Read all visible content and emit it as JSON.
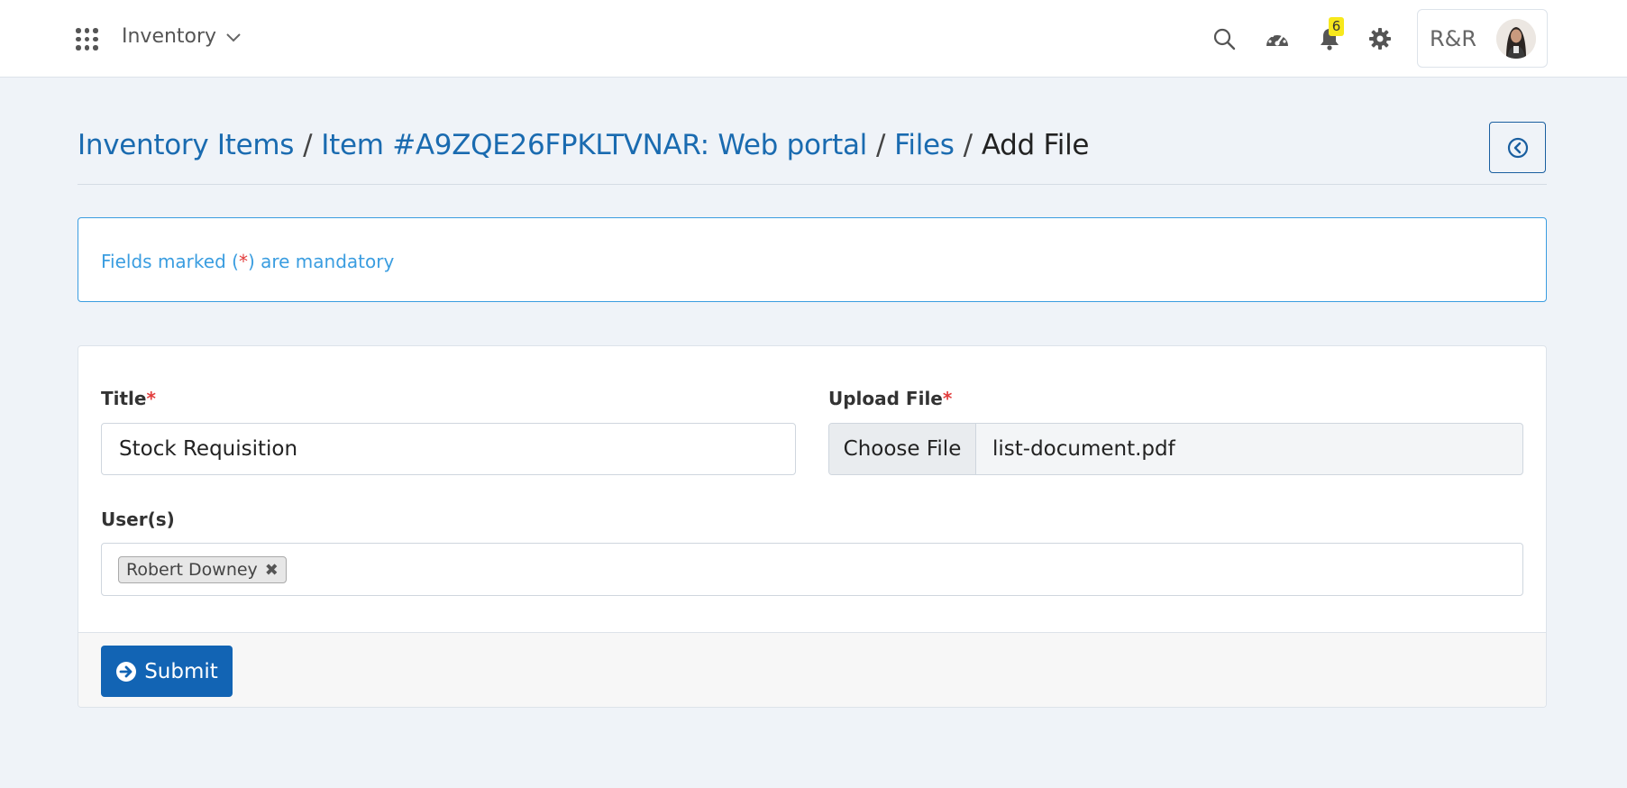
{
  "topbar": {
    "module_name": "Inventory",
    "notification_count": "6",
    "user_initials": "R&R"
  },
  "breadcrumb": {
    "items": [
      "Inventory Items",
      "Item #A9ZQE26FPKLTVNAR: Web portal",
      "Files"
    ],
    "current": "Add File",
    "separator": "/"
  },
  "alert": {
    "prefix": "Fields marked (",
    "asterisk": "*",
    "suffix": ") are mandatory"
  },
  "form": {
    "title_label": "Title",
    "title_value": "Stock Requisition",
    "upload_label": "Upload File",
    "upload_button": "Choose File",
    "upload_filename": "list-document.pdf",
    "users_label": "User(s)",
    "users_selected": [
      "Robert Downey"
    ],
    "required_mark": "*",
    "submit_label": "Submit"
  },
  "colors": {
    "link": "#1a6bb0",
    "primary_button": "#1264b4",
    "info": "#3a9de0",
    "required": "#e23d3d",
    "badge": "#f7e81c"
  }
}
